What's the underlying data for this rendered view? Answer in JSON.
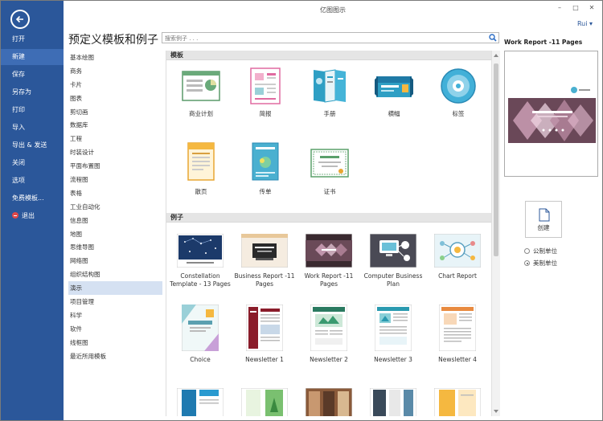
{
  "window": {
    "title": "亿图图示",
    "user": "Rui",
    "minimize": "–",
    "maximize": "□",
    "close": "✕"
  },
  "nav": {
    "items": [
      {
        "label": "打开"
      },
      {
        "label": "新建",
        "active": true
      },
      {
        "label": "保存"
      },
      {
        "label": "另存为"
      },
      {
        "label": "打印"
      },
      {
        "label": "导入"
      },
      {
        "label": "导出 & 发送"
      },
      {
        "label": "关闭"
      },
      {
        "label": "选项"
      },
      {
        "label": "免费模板..."
      },
      {
        "label": "退出",
        "icon": "exit-icon"
      }
    ]
  },
  "heading": "预定义模板和例子",
  "search": {
    "placeholder": "搜索例子 . . .",
    "value": ""
  },
  "categories": [
    "基本绘图",
    "商务",
    "卡片",
    "图表",
    "剪切画",
    "数据库",
    "工程",
    "时装设计",
    "平面布置图",
    "流程图",
    "表格",
    "工业自动化",
    "信息图",
    "地图",
    "思维导图",
    "网络图",
    "组织结构图",
    "演示",
    "项目管理",
    "科学",
    "软件",
    "线框图",
    "最近所用模板"
  ],
  "active_category": "演示",
  "templates": {
    "header": "模板",
    "items": [
      "商业计划",
      "简报",
      "手册",
      "横幅",
      "标签",
      "散页",
      "传单",
      "证书"
    ]
  },
  "examples": {
    "header": "例子",
    "items": [
      "Constellation Template - 13 Pages",
      "Business Report -11 Pages",
      "Work Report -11 Pages",
      "Computer Business Plan",
      "Chart Report",
      "Choice",
      "Newsletter 1",
      "Newsletter 2",
      "Newsletter 3",
      "Newsletter 4"
    ]
  },
  "preview": {
    "title": "Work Report -11 Pages"
  },
  "create": {
    "label": "创建"
  },
  "units": {
    "metric": "公制单位",
    "imperial": "美制单位",
    "selected": "imperial"
  },
  "colors": {
    "nav_bg": "#2b579a",
    "nav_active": "#3e6db5",
    "category_active": "#d5e1f2",
    "brand_accent": "#2b579a"
  }
}
